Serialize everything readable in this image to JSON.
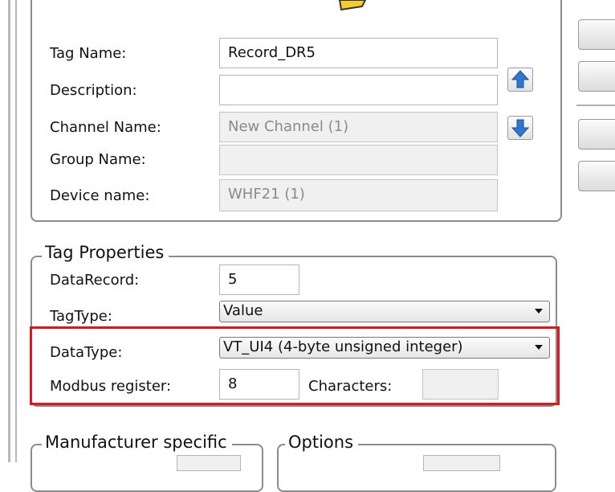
{
  "general": {
    "tag_name_label": "Tag Name:",
    "tag_name_value": "Record_DR5",
    "description_label": "Description:",
    "description_value": "",
    "channel_name_label": "Channel Name:",
    "channel_name_value": "New Channel (1)",
    "group_name_label": "Group Name:",
    "group_name_value": "",
    "device_name_label": "Device name:",
    "device_name_value": "WHF21 (1)",
    "up_icon": "arrow-up-icon",
    "down_icon": "arrow-down-icon",
    "folder_icon": "folder-icon"
  },
  "tag_properties": {
    "legend": "Tag Properties",
    "datarecord_label": "DataRecord:",
    "datarecord_value": "5",
    "tagtype_label": "TagType:",
    "tagtype_value": "Value",
    "datatype_label": "DataType:",
    "datatype_value": "VT_UI4 (4-byte unsigned integer)",
    "modbus_label": "Modbus register:",
    "modbus_value": "8",
    "characters_label": "Characters:",
    "characters_value": ""
  },
  "manufacturer": {
    "legend": "Manufacturer specific"
  },
  "options": {
    "legend": "Options"
  },
  "colors": {
    "highlight": "#e0161c",
    "arrow_blue": "#2f78d0"
  }
}
